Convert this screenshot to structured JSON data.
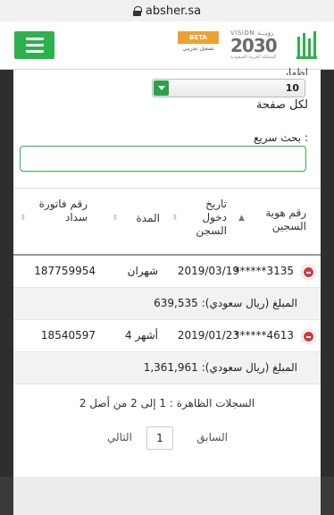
{
  "browser": {
    "url": "absher.sa"
  },
  "header": {
    "beta_label": "BETA",
    "beta_sub": "تشغيل تجريبي",
    "vision_label": "VISION",
    "vision_arabic": "رؤيـــة",
    "vision_year": "2030",
    "vision_sub": "المملكة العربية السعودية",
    "logo_icon": "absher-logo-icon",
    "menu_icon": "hamburger-menu-icon",
    "brand_color": "#2bb24c"
  },
  "controls": {
    "page_size_label_top": "إظهار",
    "page_size_value": "10",
    "per_page_label": "لكل صفحة",
    "search_label": "بحث سريع :",
    "search_value": ""
  },
  "table": {
    "headers": {
      "id": "رقم هوية السجين",
      "date": "تاريخ دخول السجن",
      "duration": "المدة",
      "bill": "رقم فاتورة سداد"
    },
    "rows": [
      {
        "id": "******3135",
        "date": "2019/03/19",
        "duration": "شهران",
        "bill": "187759954",
        "amount_label": "المبلغ (ريال سعودي):",
        "amount": "639,535"
      },
      {
        "id": "******4613",
        "date": "2019/01/23",
        "duration": "4 أشهر",
        "bill": "18540597",
        "amount_label": "المبلغ (ريال سعودي):",
        "amount": "1,361,961"
      }
    ]
  },
  "footer": {
    "records_text": "السجلات الظاهرة : 1 إلى 2 من أصل 2",
    "prev_label": "السابق",
    "current_page": "1",
    "next_label": "التالي"
  }
}
